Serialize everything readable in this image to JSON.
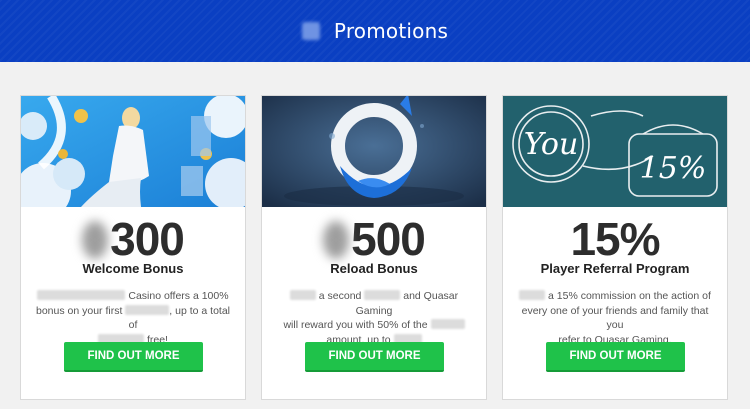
{
  "header": {
    "title": "Promotions",
    "icon": "promotions-icon"
  },
  "colors": {
    "header_bg": "#0a3fc2",
    "cta_bg": "#1fc24a",
    "card_bg": "#ffffff",
    "page_bg": "#f1f1f1"
  },
  "cards": [
    {
      "amount": "300",
      "title": "Welcome Bonus",
      "desc_1": "Casino offers a 100%",
      "desc_2": "bonus on your first",
      "desc_3": ", up to a total of",
      "desc_4": "free!",
      "cta_label": "FIND OUT MORE"
    },
    {
      "amount": "500",
      "title": "Reload Bonus",
      "desc_1": "a second",
      "desc_2": "and Quasar Gaming",
      "desc_3": "will reward you with 50% of the",
      "desc_4": "amount, up to",
      "cta_label": "FIND OUT MORE"
    },
    {
      "amount": "15%",
      "title": "Player Referral Program",
      "desc_1": "a 15% commission on the action of",
      "desc_2": "every one of your friends and family that you",
      "desc_3": "refer to Quasar Gaming.",
      "cta_label": "FIND OUT MORE",
      "image_text_1": "You",
      "image_text_2": "15%"
    }
  ]
}
